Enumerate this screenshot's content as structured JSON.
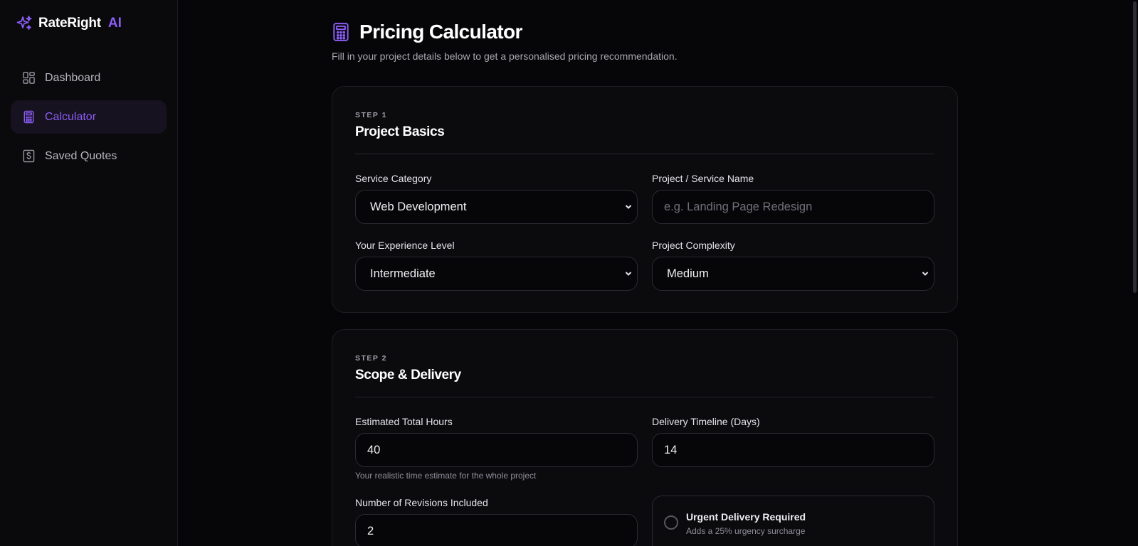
{
  "app": {
    "brand_name": "RateRight",
    "brand_suffix": "AI",
    "accent": "#8b5cf6"
  },
  "sidebar": {
    "items": [
      {
        "label": "Dashboard",
        "icon": "dashboard-icon",
        "active": false
      },
      {
        "label": "Calculator",
        "icon": "calculator-icon",
        "active": true
      },
      {
        "label": "Saved Quotes",
        "icon": "dollar-document-icon",
        "active": false
      }
    ]
  },
  "header": {
    "title": "Pricing Calculator",
    "subtitle": "Fill in your project details below to get a personalised pricing recommendation."
  },
  "step1": {
    "label": "STEP 1",
    "title": "Project Basics",
    "service_category": {
      "label": "Service Category",
      "value": "Web Development"
    },
    "service_name": {
      "label": "Project / Service Name",
      "placeholder": "e.g. Landing Page Redesign"
    },
    "experience": {
      "label": "Your Experience Level",
      "value": "Intermediate"
    },
    "complexity": {
      "label": "Project Complexity",
      "value": "Medium"
    }
  },
  "step2": {
    "label": "STEP 2",
    "title": "Scope & Delivery",
    "hours": {
      "label": "Estimated Total Hours",
      "value": "40",
      "hint": "Your realistic time estimate for the whole project"
    },
    "timeline": {
      "label": "Delivery Timeline (Days)",
      "value": "14"
    },
    "revisions": {
      "label": "Number of Revisions Included",
      "value": "2"
    },
    "urgent": {
      "title": "Urgent Delivery Required",
      "subtitle": "Adds a 25% urgency surcharge"
    }
  }
}
